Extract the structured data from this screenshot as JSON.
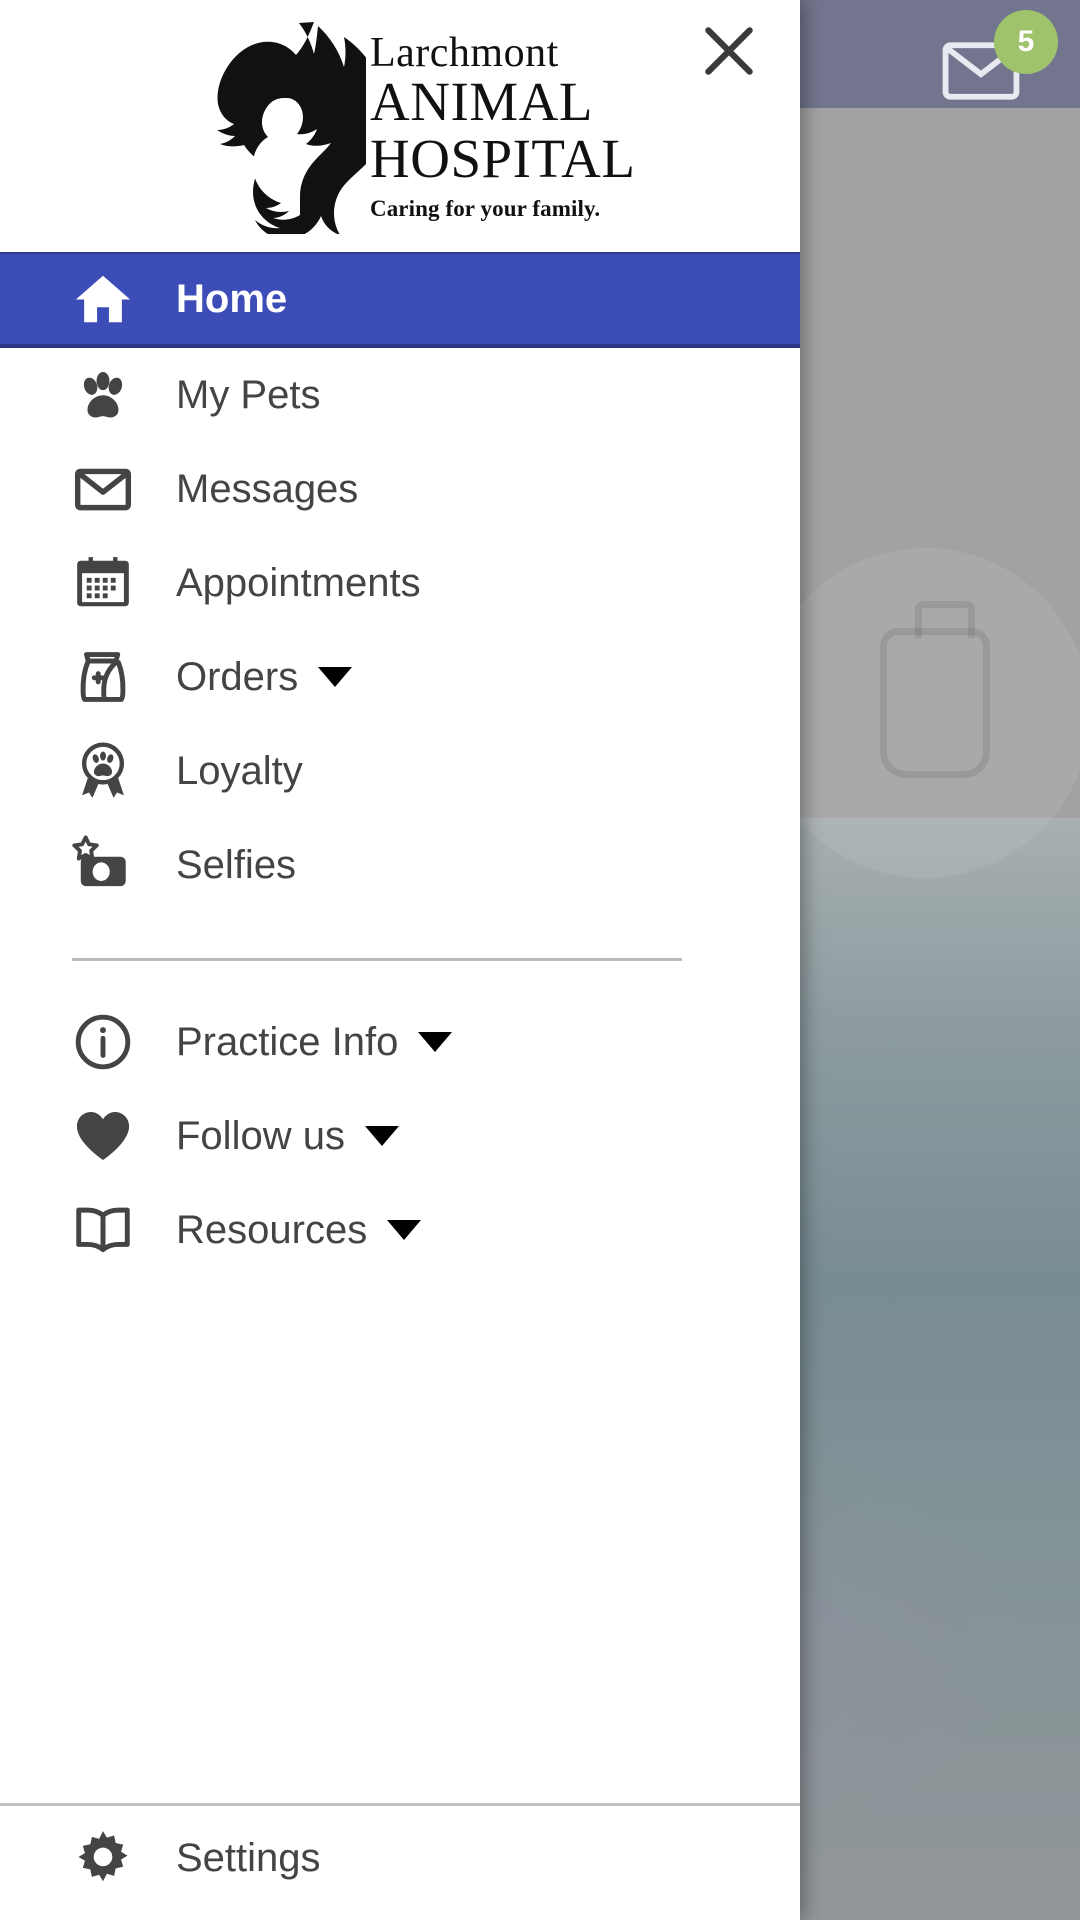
{
  "background": {
    "badge_count": "5",
    "mail_icon": "mail-icon"
  },
  "drawer": {
    "logo": {
      "line1": "Larchmont",
      "line2": "ANIMAL",
      "line3": "HOSPITAL",
      "tagline": "Caring for your family.",
      "mark_icon": "dog-cat-silhouette-icon"
    },
    "close_icon": "close-icon",
    "main_items": [
      {
        "label": "Home",
        "icon": "home-icon",
        "active": true,
        "caret": false
      },
      {
        "label": "My Pets",
        "icon": "paw-icon",
        "active": false,
        "caret": false
      },
      {
        "label": "Messages",
        "icon": "envelope-icon",
        "active": false,
        "caret": false
      },
      {
        "label": "Appointments",
        "icon": "calendar-icon",
        "active": false,
        "caret": false
      },
      {
        "label": "Orders",
        "icon": "pet-food-bag-icon",
        "active": false,
        "caret": true
      },
      {
        "label": "Loyalty",
        "icon": "award-paw-icon",
        "active": false,
        "caret": false
      },
      {
        "label": "Selfies",
        "icon": "camera-star-icon",
        "active": false,
        "caret": false
      }
    ],
    "secondary_items": [
      {
        "label": "Practice Info",
        "icon": "info-circle-icon",
        "caret": true
      },
      {
        "label": "Follow us",
        "icon": "heart-icon",
        "caret": true
      },
      {
        "label": "Resources",
        "icon": "open-book-icon",
        "caret": true
      }
    ],
    "footer_items": [
      {
        "label": "Settings",
        "icon": "gear-icon",
        "caret": false
      }
    ]
  },
  "colors": {
    "active_blue": "#3d4db7",
    "icon_grey": "#444444",
    "badge_green": "#9ec36a"
  }
}
